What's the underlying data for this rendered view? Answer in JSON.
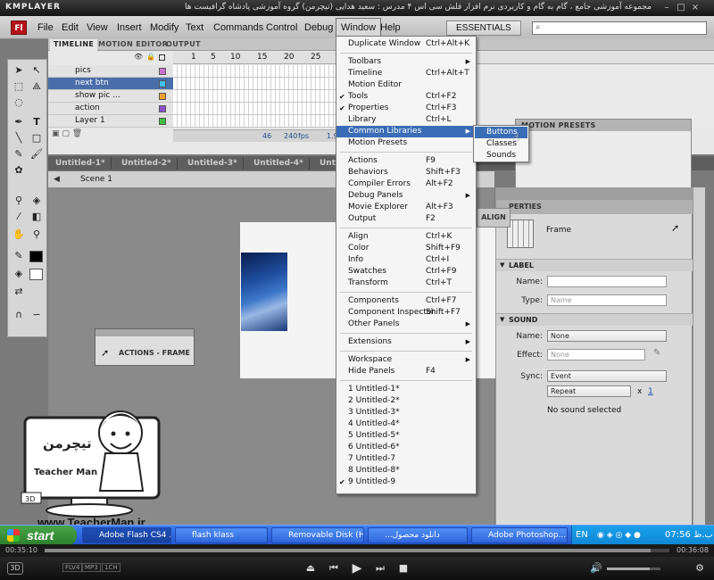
{
  "player": {
    "name": "KMPLAYER",
    "title": "مجموعه آموزشی جامع ، گام به گام و کاربردی نرم افزار فلش سی اس ۴ مدرس : سعید هدایی (تیچرمن) گروه آموزشی پادشاه گرافیست ها",
    "time_elapsed": "00:35:10",
    "time_total": "00:36:08",
    "badges": [
      "FLV4",
      "MP3",
      "1CH"
    ]
  },
  "flash": {
    "logo": "Fl",
    "menu": [
      "File",
      "Edit",
      "View",
      "Insert",
      "Modify",
      "Text",
      "Commands",
      "Control",
      "Debug",
      "Window",
      "Help"
    ],
    "workspace": "ESSENTIALS",
    "timeline_tabs": [
      "TIMELINE",
      "MOTION EDITOR",
      "OUTPUT"
    ],
    "layers": [
      "pics",
      "next btn",
      "show pic ...",
      "action",
      "Layer 1"
    ],
    "frame_numbers": [
      "1",
      "5",
      "10",
      "15",
      "20",
      "25",
      "30"
    ],
    "timeline_status": {
      "frame": "46",
      "fps": "240",
      "fps_unit": "fps",
      "time": "1.9s"
    },
    "doc_tabs": [
      "Untitled-1*",
      "Untitled-2*",
      "Untitled-3*",
      "Untitled-4*",
      "Untitled-5*"
    ],
    "scene": "Scene 1",
    "actions_panel": "ACTIONS - FRAME",
    "align_panel": "ALIGN",
    "motion_presets": "MOTION PRESETS",
    "properties": {
      "header": "PERTIES",
      "frame_label": "Frame",
      "label_section": "LABEL",
      "name_label": "Name:",
      "type_label": "Type:",
      "type_value": "Name",
      "sound_section": "SOUND",
      "sound_name_label": "Name:",
      "sound_name_value": "None",
      "effect_label": "Effect:",
      "effect_value": "None",
      "sync_label": "Sync:",
      "sync_value": "Event",
      "repeat_value": "Repeat",
      "repeat_x": "x",
      "repeat_count": "1",
      "no_sound": "No sound selected"
    }
  },
  "window_menu": {
    "items": [
      {
        "label": "Duplicate Window",
        "shortcut": "Ctrl+Alt+K"
      },
      {
        "sep": true
      },
      {
        "label": "Toolbars",
        "arrow": true
      },
      {
        "label": "Timeline",
        "shortcut": "Ctrl+Alt+T"
      },
      {
        "label": "Motion Editor"
      },
      {
        "label": "Tools",
        "shortcut": "Ctrl+F2",
        "check": true
      },
      {
        "label": "Properties",
        "shortcut": "Ctrl+F3",
        "check": true
      },
      {
        "label": "Library",
        "shortcut": "Ctrl+L"
      },
      {
        "label": "Common Libraries",
        "arrow": true,
        "highlight": true
      },
      {
        "label": "Motion Presets"
      },
      {
        "sep": true
      },
      {
        "label": "Actions",
        "shortcut": "F9"
      },
      {
        "label": "Behaviors",
        "shortcut": "Shift+F3"
      },
      {
        "label": "Compiler Errors",
        "shortcut": "Alt+F2"
      },
      {
        "label": "Debug Panels",
        "arrow": true
      },
      {
        "label": "Movie Explorer",
        "shortcut": "Alt+F3"
      },
      {
        "label": "Output",
        "shortcut": "F2"
      },
      {
        "sep": true
      },
      {
        "label": "Align",
        "shortcut": "Ctrl+K"
      },
      {
        "label": "Color",
        "shortcut": "Shift+F9"
      },
      {
        "label": "Info",
        "shortcut": "Ctrl+I"
      },
      {
        "label": "Swatches",
        "shortcut": "Ctrl+F9"
      },
      {
        "label": "Transform",
        "shortcut": "Ctrl+T"
      },
      {
        "sep": true
      },
      {
        "label": "Components",
        "shortcut": "Ctrl+F7"
      },
      {
        "label": "Component Inspector",
        "shortcut": "Shift+F7"
      },
      {
        "label": "Other Panels",
        "arrow": true
      },
      {
        "sep": true
      },
      {
        "label": "Extensions",
        "arrow": true
      },
      {
        "sep": true
      },
      {
        "label": "Workspace",
        "arrow": true
      },
      {
        "label": "Hide Panels",
        "shortcut": "F4"
      },
      {
        "sep": true
      },
      {
        "label": "1 Untitled-1*"
      },
      {
        "label": "2 Untitled-2*"
      },
      {
        "label": "3 Untitled-3*"
      },
      {
        "label": "4 Untitled-4*"
      },
      {
        "label": "5 Untitled-5*"
      },
      {
        "label": "6 Untitled-6*"
      },
      {
        "label": "7 Untitled-7"
      },
      {
        "label": "8 Untitled-8*"
      },
      {
        "label": "9 Untitled-9",
        "check": true
      }
    ]
  },
  "submenu": {
    "items": [
      "Buttons",
      "Classes",
      "Sounds"
    ],
    "highlight": 0
  },
  "watermark": {
    "site": "www.TeacherMan.ir",
    "name": "Teacher Man",
    "logo_text": "تیچرمن"
  },
  "taskbar": {
    "start": "start",
    "tasks": [
      "Adobe Flash CS4 ...",
      "flash klass",
      "Removable Disk (H:)",
      "...دانلود محصول",
      "Adobe Photoshop..."
    ],
    "lang": "EN",
    "clock": "07:56 ب.ظ"
  }
}
